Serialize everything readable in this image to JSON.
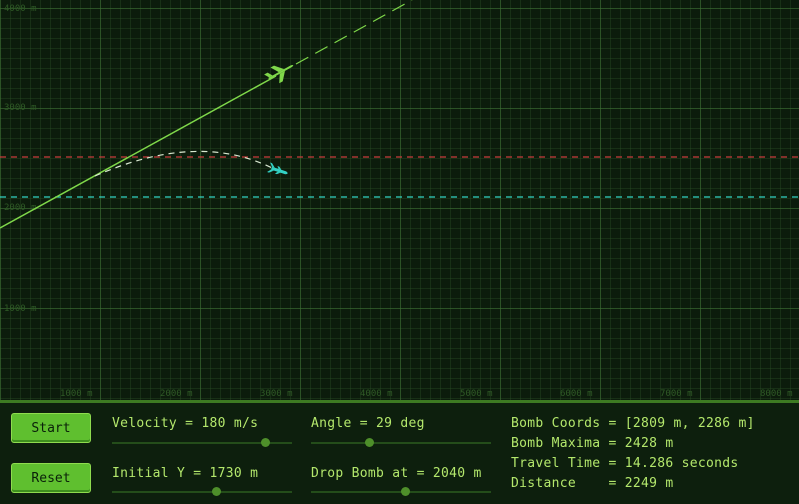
{
  "scene": {
    "y_axis_labels": [
      "4000 m",
      "3000 m",
      "2000 m",
      "1000 m"
    ],
    "x_axis_labels": [
      "1000 m",
      "2000 m",
      "3000 m",
      "4000 m",
      "5000 m",
      "6000 m",
      "7000 m",
      "8000 m"
    ],
    "colors": {
      "plane": "#7fd84a",
      "bomb": "#33d1c4",
      "maxima_line": "#c83c3c",
      "target_line": "#33d1c4",
      "flight_path": "#7fd84a"
    },
    "icons": {
      "plane": "plane-icon",
      "bomb": "bomb-icon"
    }
  },
  "controls": {
    "start_label": "Start",
    "reset_label": "Reset",
    "velocity_text": "Velocity = 180 m/s",
    "angle_text": "Angle = 29 deg",
    "initial_y_text": "Initial Y = 1730 m",
    "drop_bomb_text": "Drop Bomb at = 2040 m",
    "velocity_level": 0.85,
    "angle_level": 0.32,
    "initial_y_level": 0.58,
    "drop_level": 0.52
  },
  "readout": {
    "coords_text": "Bomb Coords = [2809 m, 2286 m]",
    "maxima_text": "Bomb Maxima = 2428 m",
    "time_text": "Travel Time = 14.286 seconds",
    "distance_text": "Distance    = 2249 m"
  }
}
